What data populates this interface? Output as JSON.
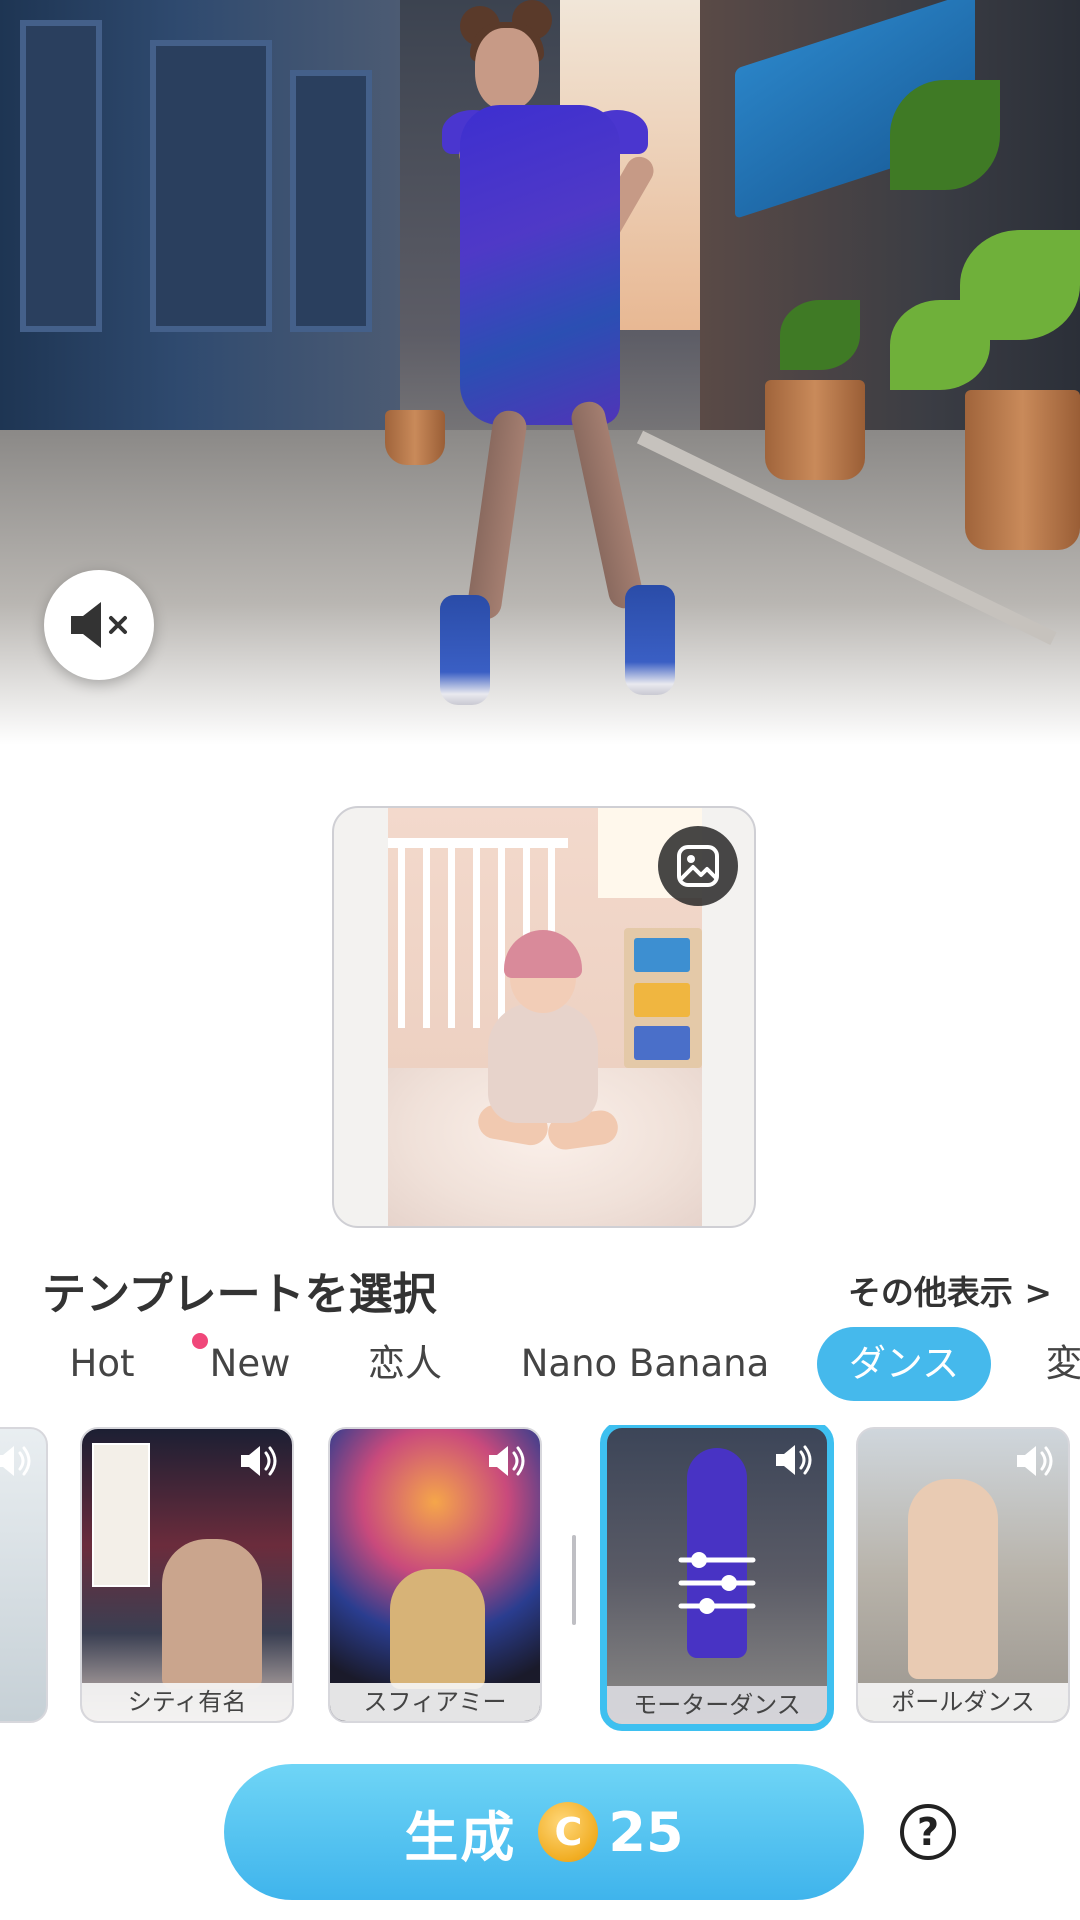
{
  "hero": {
    "mute_icon": "speaker-muted-icon"
  },
  "upload": {
    "change_photo_icon": "gallery-icon"
  },
  "templates": {
    "title": "テンプレートを選択",
    "more": "その他表示 >"
  },
  "tabs": [
    {
      "label": "Hot",
      "active": false
    },
    {
      "label": "New",
      "active": false,
      "badge": true
    },
    {
      "label": "恋人",
      "active": false
    },
    {
      "label": "Nano Banana",
      "active": false
    },
    {
      "label": "ダンス",
      "active": true
    },
    {
      "label": "変",
      "active": false
    }
  ],
  "thumbnails": [
    {
      "caption": "シティ有名",
      "icon": "speaker-icon"
    },
    {
      "caption": "スフィアミー",
      "icon": "speaker-icon"
    },
    {
      "caption": "モーターダンス",
      "icon": "speaker-icon",
      "selected": true
    },
    {
      "caption": "ポールダンス",
      "icon": "speaker-icon"
    }
  ],
  "generate": {
    "label": "生成",
    "coin_symbol": "C",
    "cost": "25"
  },
  "help": {
    "label": "?"
  },
  "colors": {
    "accent": "#45b9ec",
    "badge": "#f0477a",
    "coin": "#f1ad22"
  }
}
